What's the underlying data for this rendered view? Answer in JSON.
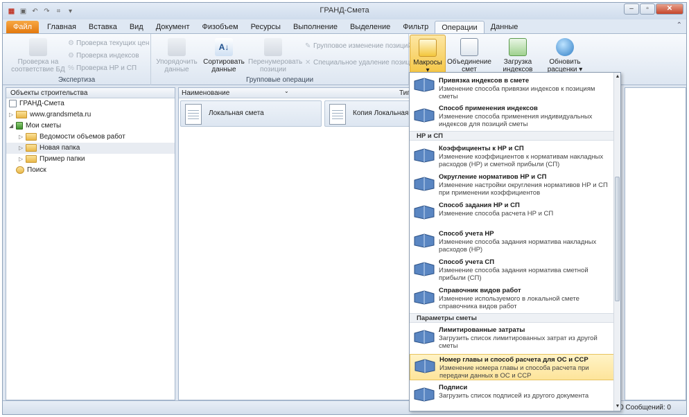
{
  "window": {
    "title": "ГРАНД-Смета"
  },
  "tabs": [
    "Файл",
    "Главная",
    "Вставка",
    "Вид",
    "Документ",
    "Физобъем",
    "Ресурсы",
    "Выполнение",
    "Выделение",
    "Фильтр",
    "Операции",
    "Данные"
  ],
  "ribbon": {
    "expertise": {
      "label": "Экспертиза",
      "check_db": "Проверка на соответствие БД",
      "check_prices": "Проверка текущих цен",
      "check_indexes": "Проверка индексов",
      "check_hr": "Проверка НР и СП"
    },
    "group_ops": {
      "label": "Групповые операции",
      "order": "Упорядочить данные",
      "sort": "Сортировать данные",
      "renumber": "Перенумеровать позиции",
      "group_change": "Групповое изменение позиций",
      "special_delete": "Специальное удаление позиций"
    },
    "macros": "Макросы",
    "merge": "Объединение смет",
    "load_indexes": "Загрузка индексов",
    "update_prices": "Обновить расценки"
  },
  "tree": {
    "header": "Объекты строительства",
    "items": [
      {
        "label": "ГРАНД-Смета"
      },
      {
        "label": "www.grandsmeta.ru"
      },
      {
        "label": "Мои сметы"
      },
      {
        "label": "Ведомости объемов работ"
      },
      {
        "label": "Новая папка"
      },
      {
        "label": "Пример папки"
      },
      {
        "label": "Поиск"
      }
    ]
  },
  "main": {
    "col_name": "Наименование",
    "col_type": "Тип",
    "cards": [
      {
        "label": "Локальная смета"
      },
      {
        "label": "Копия Локальная сме"
      }
    ]
  },
  "status": {
    "messages": "0 Сообщений: 0"
  },
  "dropdown": {
    "items": [
      {
        "title": "Привязка индексов в смете",
        "desc": "Изменение способа привязки индексов к позициям сметы"
      },
      {
        "title": "Способ применения индексов",
        "desc": "Изменение способа применения индивидуальных индексов для позиций сметы"
      },
      {
        "section": "НР и СП"
      },
      {
        "title": "Коэффициенты к НР и СП",
        "desc": "Изменение коэффициентов к нормативам накладных расходов (НР) и сметной прибыли (СП)"
      },
      {
        "title": "Округление нормативов НР и СП",
        "desc": "Изменение настройки округления нормативов НР и СП при применении коэффициентов"
      },
      {
        "title": "Способ задания НР и СП",
        "desc": "Изменение способа расчета НР и СП"
      },
      {
        "title": "Способ учета НР",
        "desc": "Изменение способа задания норматива накладных расходов (НР)"
      },
      {
        "title": "Способ учета СП",
        "desc": "Изменение способа задания норматива сметной прибыли (СП)"
      },
      {
        "title": "Справочник видов работ",
        "desc": "Изменение используемого в локальной смете справочника видов работ"
      },
      {
        "section": "Параметры сметы"
      },
      {
        "title": "Лимитированные затраты",
        "desc": "Загрузить список лимитированных затрат из другой сметы"
      },
      {
        "title": "Номер главы и способ расчета для ОС и ССР",
        "desc": "Изменение номера главы и способа расчета при передачи данных в ОС и ССР"
      },
      {
        "title": "Подписи",
        "desc": "Загрузить список подписей из другого документа"
      }
    ]
  },
  "colors": {
    "accent": "#f5c747",
    "file_tab": "#e3780d",
    "highlight": "#fde49a"
  }
}
